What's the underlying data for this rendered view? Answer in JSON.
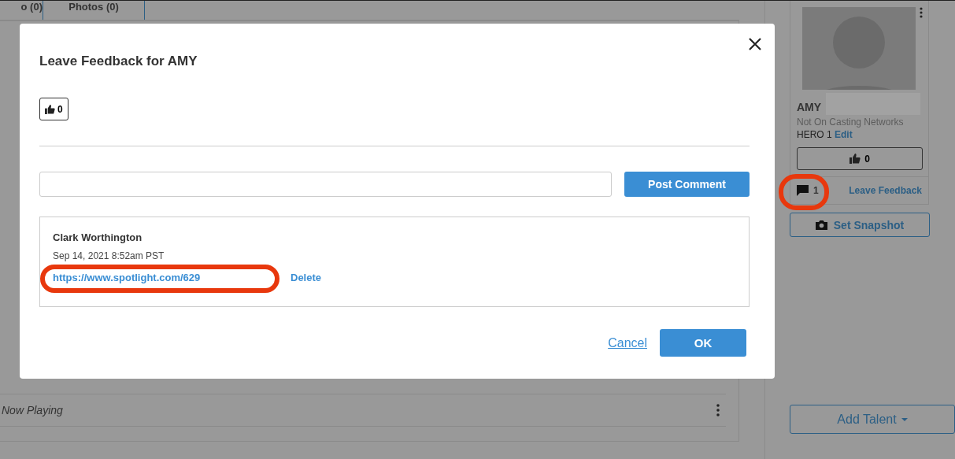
{
  "background": {
    "tabs": [
      {
        "label": "o (0)"
      },
      {
        "label": "Photos (0)"
      }
    ],
    "rows": [
      {
        "label": "Now Playing"
      }
    ]
  },
  "talent_card": {
    "name": "AMY",
    "status": "Not On Casting Networks",
    "role": "HERO 1",
    "edit_link": "Edit",
    "likes": "0",
    "comment_count": {
      "text": "1",
      "highlighted": true
    },
    "leave_feedback": "Leave Feedback",
    "snapshot_button": "Set Snapshot"
  },
  "add_talent_button": "Add Talent",
  "modal": {
    "title": "Leave Feedback for AMY",
    "likes": "0",
    "post_button": "Post Comment",
    "comments": [
      {
        "author": "Clark Worthington",
        "date": "Sep 14, 2021 8:52am PST",
        "link": "https://www.spotlight.com/629",
        "link_highlighted": true,
        "delete": "Delete"
      }
    ],
    "cancel": "Cancel",
    "ok": "OK"
  }
}
